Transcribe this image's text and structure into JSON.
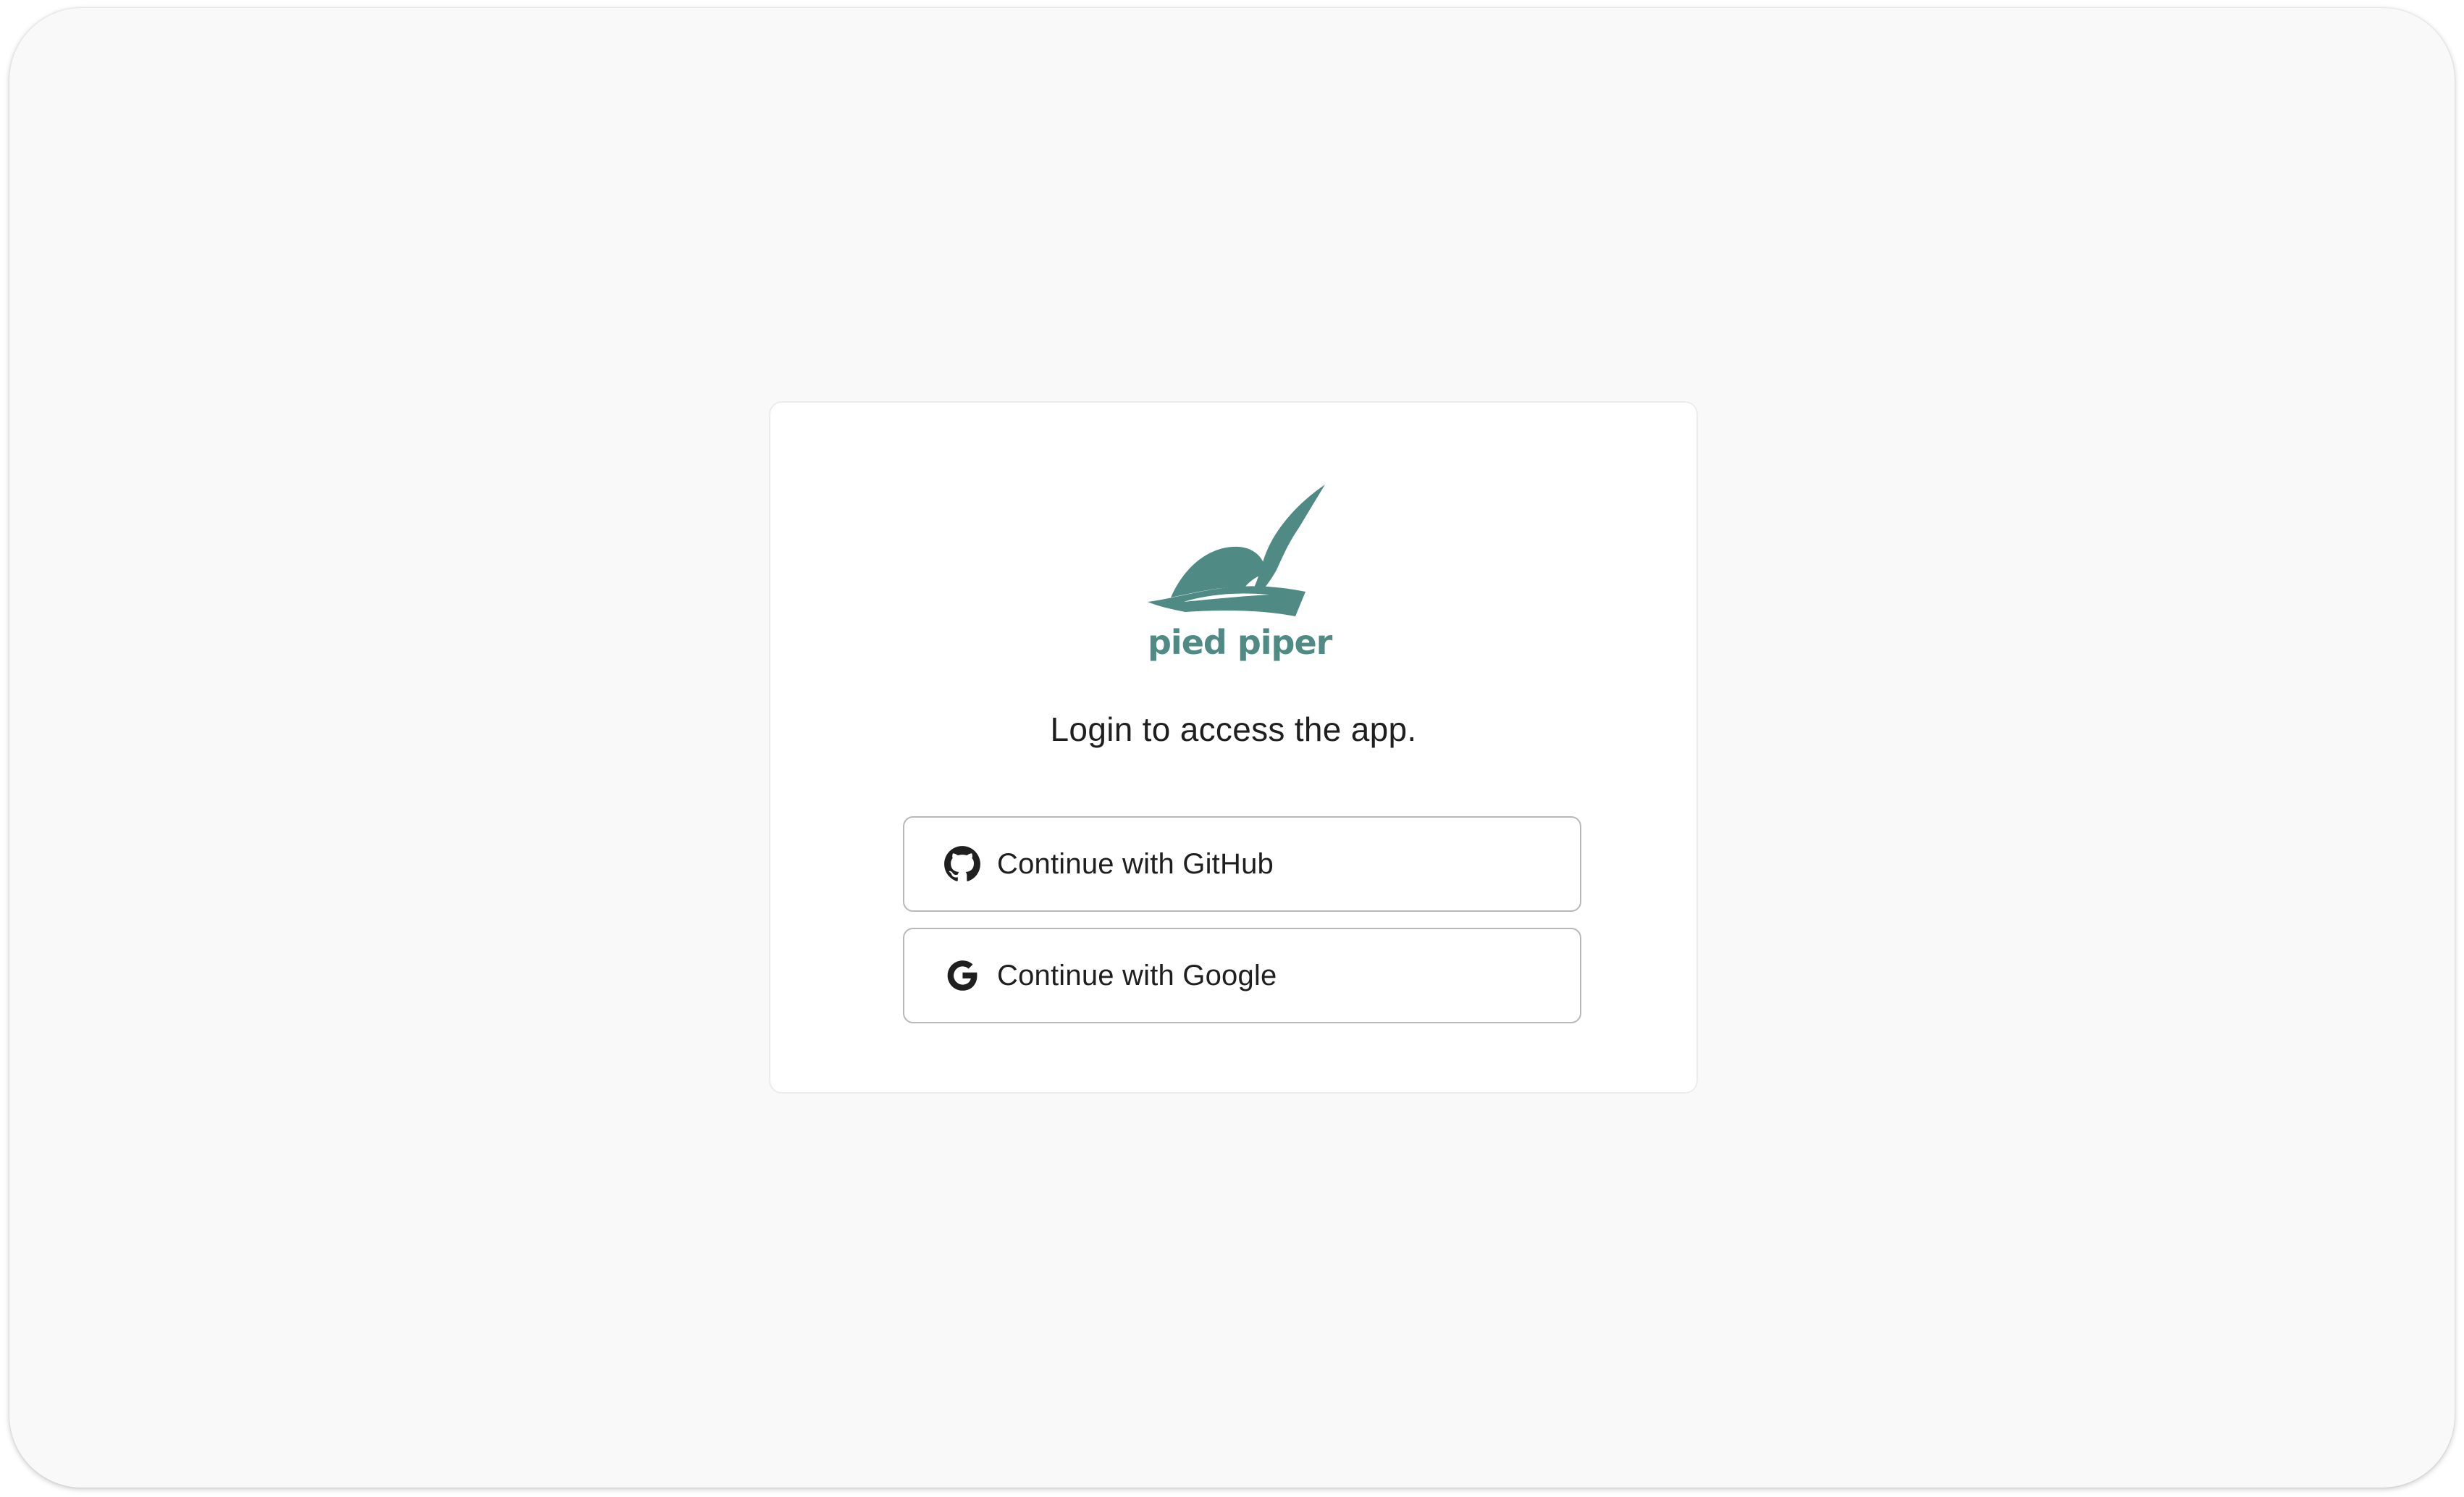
{
  "brand": {
    "name": "pied piper",
    "color": "#4f8a85"
  },
  "login": {
    "prompt": "Login to access the app."
  },
  "providers": [
    {
      "label": "Continue with GitHub",
      "icon": "github-icon"
    },
    {
      "label": "Continue with Google",
      "icon": "google-icon"
    }
  ],
  "colors": {
    "background": "#f9f9f9",
    "card": "#ffffff",
    "text": "#1f1f1f",
    "border": "#b8b8b8"
  }
}
